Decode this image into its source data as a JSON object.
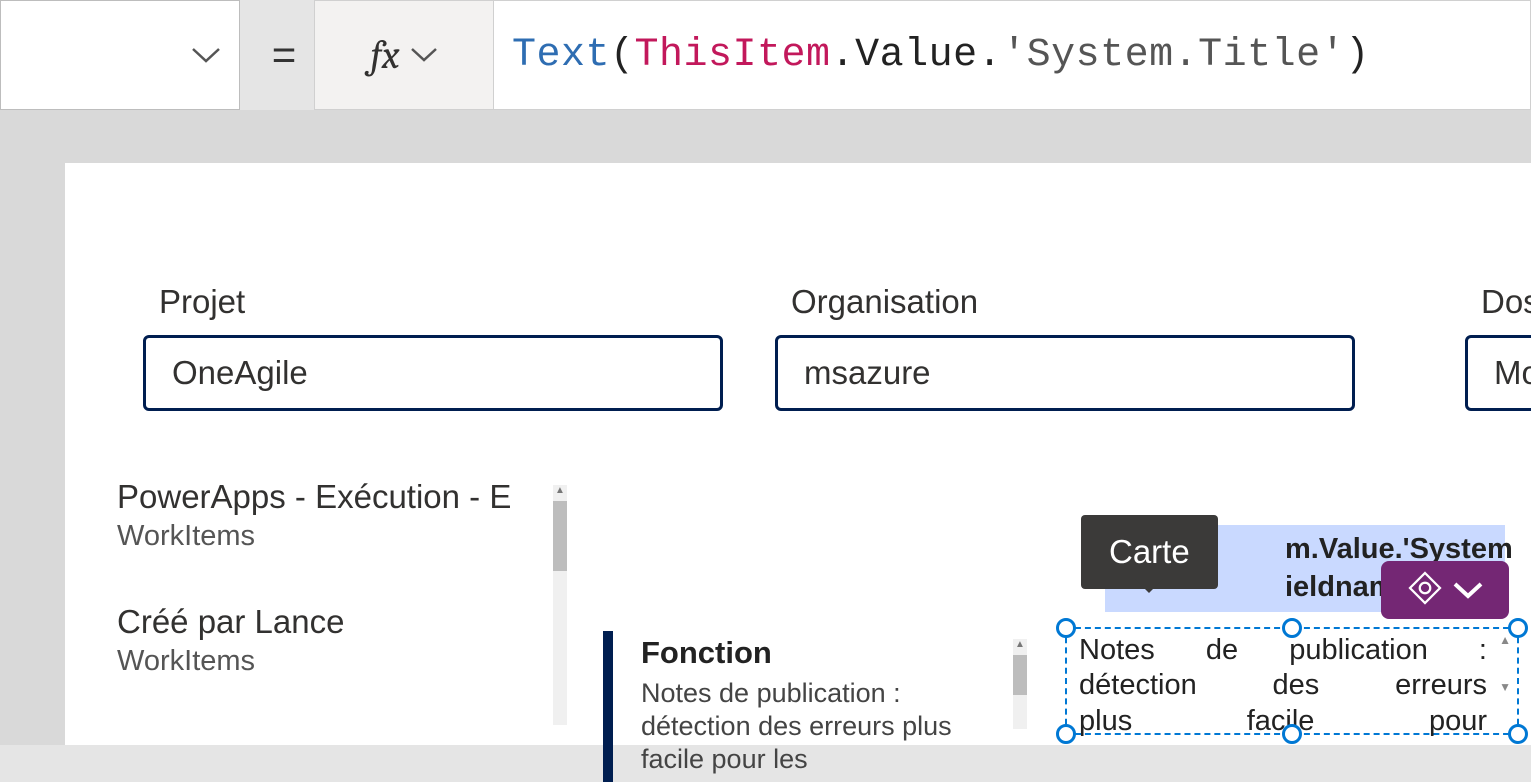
{
  "formula": {
    "fn": "Text",
    "item": "ThisItem",
    "dot1": ".",
    "value": "Value",
    "dot2": ".",
    "literal": "'System.Title'"
  },
  "fields": {
    "projet": {
      "label": "Projet",
      "value": "OneAgile"
    },
    "organisation": {
      "label": "Organisation",
      "value": "msazure"
    },
    "dossier": {
      "label": "Doss",
      "value": "Mo"
    }
  },
  "list": [
    {
      "title": "PowerApps - Exécution - E",
      "sub": "WorkItems"
    },
    {
      "title": "Créé par Lance",
      "sub": "WorkItems"
    }
  ],
  "detail": {
    "head": "Fonction",
    "body": "Notes de publication : détection des erreurs plus facile pour les"
  },
  "selectedPreview": {
    "line1": "m.Value.'System",
    "line2": "ieldname:"
  },
  "tooltip": "Carte",
  "selectedText": {
    "l1": "Notes de publication :",
    "l2": "détection des erreurs",
    "l3": "plus facile pour"
  }
}
